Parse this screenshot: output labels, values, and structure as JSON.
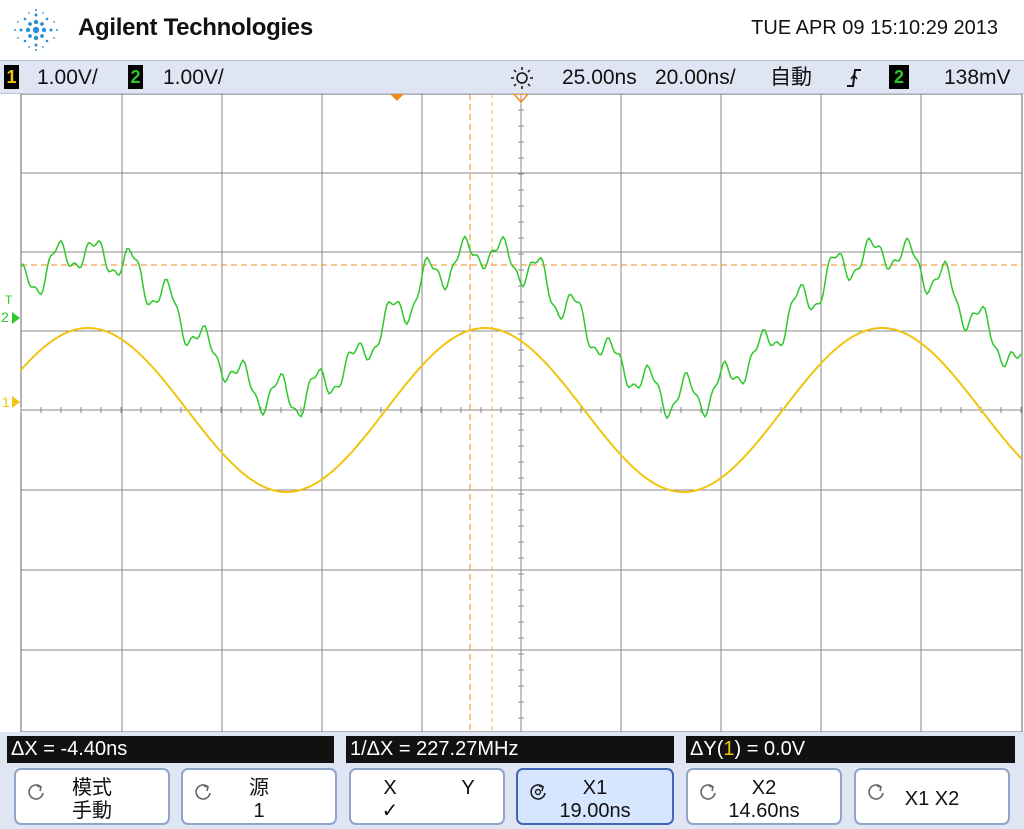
{
  "header": {
    "brand": "Agilent Technologies",
    "datetime": "TUE APR 09 15:10:29 2013"
  },
  "status": {
    "ch1_num": "1",
    "ch1_scale": "1.00V/",
    "ch2_num": "2",
    "ch2_scale": "1.00V/",
    "time_delay": "25.00ns",
    "time_scale": "20.00ns/",
    "trigger_mode": "自動",
    "trigger_slope_icon": "rising-edge-icon",
    "trigger_source": "2",
    "trigger_level": "138mV"
  },
  "markers": {
    "ch2": "2",
    "ch2_trigger": "T",
    "ch1": "1"
  },
  "colors": {
    "ch1": "#f2c40e",
    "ch2": "#2ec82a",
    "cursor": "#f08a1a",
    "grid": "#888888"
  },
  "measurements": {
    "delta_x": "ΔX = -4.40ns",
    "inv_delta_x": "1/ΔX = 227.27MHz",
    "delta_y_prefix": "ΔY(",
    "delta_y_ch": "1",
    "delta_y_suffix": ") = 0.0V"
  },
  "softkeys": {
    "mode_l1": "模式",
    "mode_l2": "手動",
    "source_l1": "源",
    "source_l2": "1",
    "x_label": "X",
    "y_label": "Y",
    "xy_check": "✓",
    "x1_l1": "X1",
    "x1_l2": "19.00ns",
    "x2_l1": "X2",
    "x2_l2": "14.60ns",
    "x1x2": "X1 X2"
  }
}
